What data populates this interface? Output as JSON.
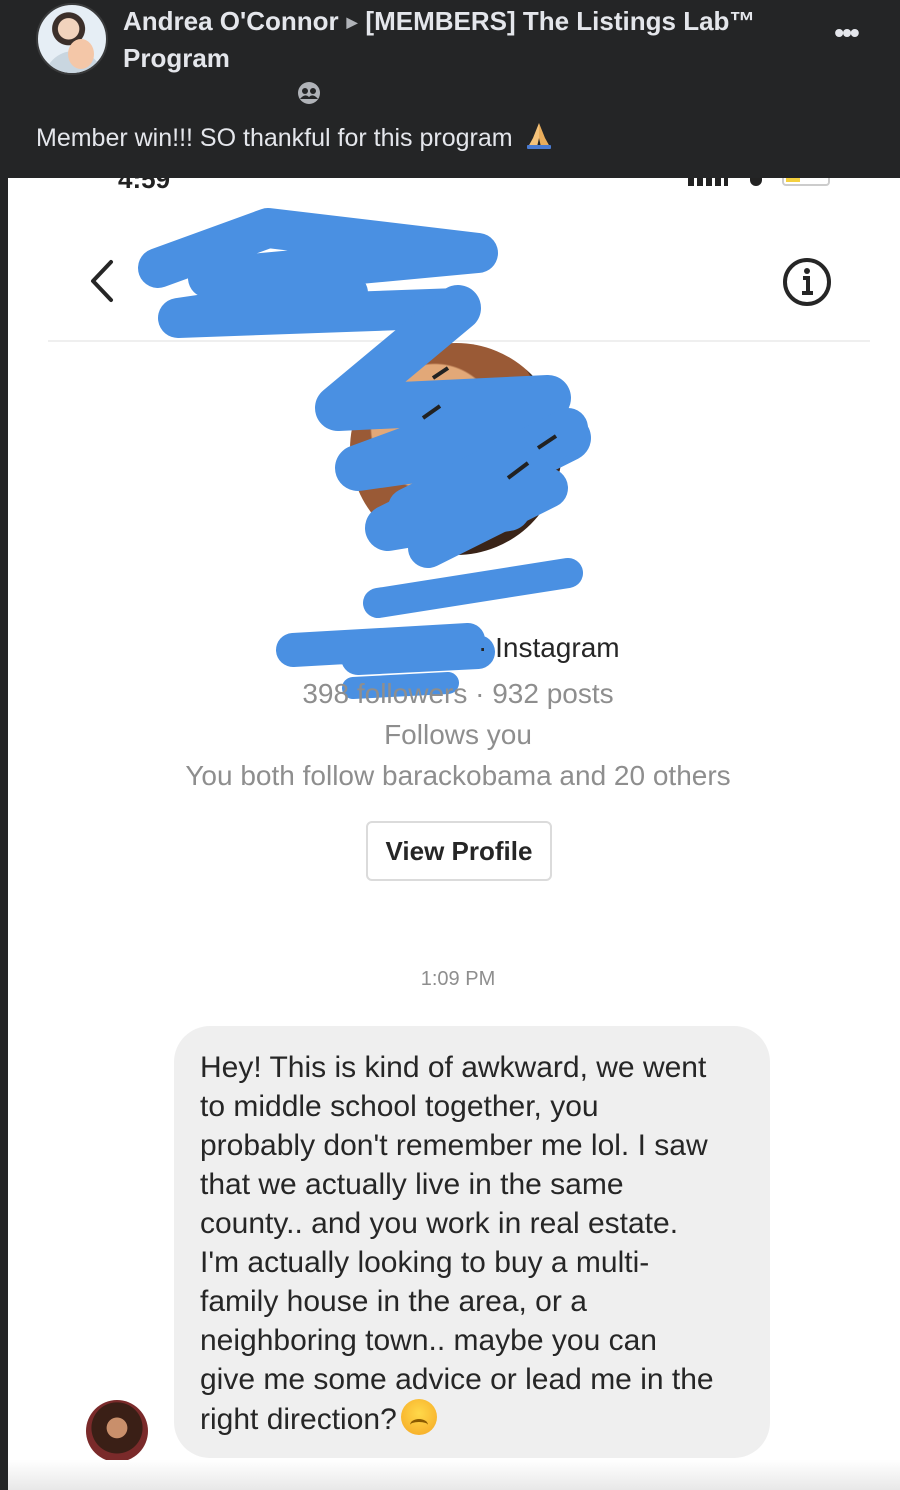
{
  "post": {
    "author": "Andrea O'Connor",
    "group": "[MEMBERS] The Listings Lab™ Program",
    "text": "Member win!!! SO thankful for this program",
    "audience_icon": "group-icon",
    "more_icon": "ellipsis-icon",
    "more_label": "•••"
  },
  "dm": {
    "status_time": "4:59",
    "back_icon": "chevron-left-icon",
    "info_icon": "info-icon",
    "instagram_label": "· Instagram",
    "stats": "398 followers · 932 posts",
    "follows_you": "Follows you",
    "mutual": "You both follow barackobama and 20 others",
    "view_profile": "View Profile",
    "timestamp": "1:09 PM",
    "message": "Hey! This is kind of awkward, we went\nto middle school together, you\nprobably don't remember me lol. I saw\nthat we actually live in the same\ncounty.. and you work in real estate.\nI'm actually looking to buy a multi-\nfamily house in the area, or a\nneighboring town.. maybe you can\ngive me some advice or lead me in the\nright direction?",
    "redaction_color": "#4a90e2"
  }
}
